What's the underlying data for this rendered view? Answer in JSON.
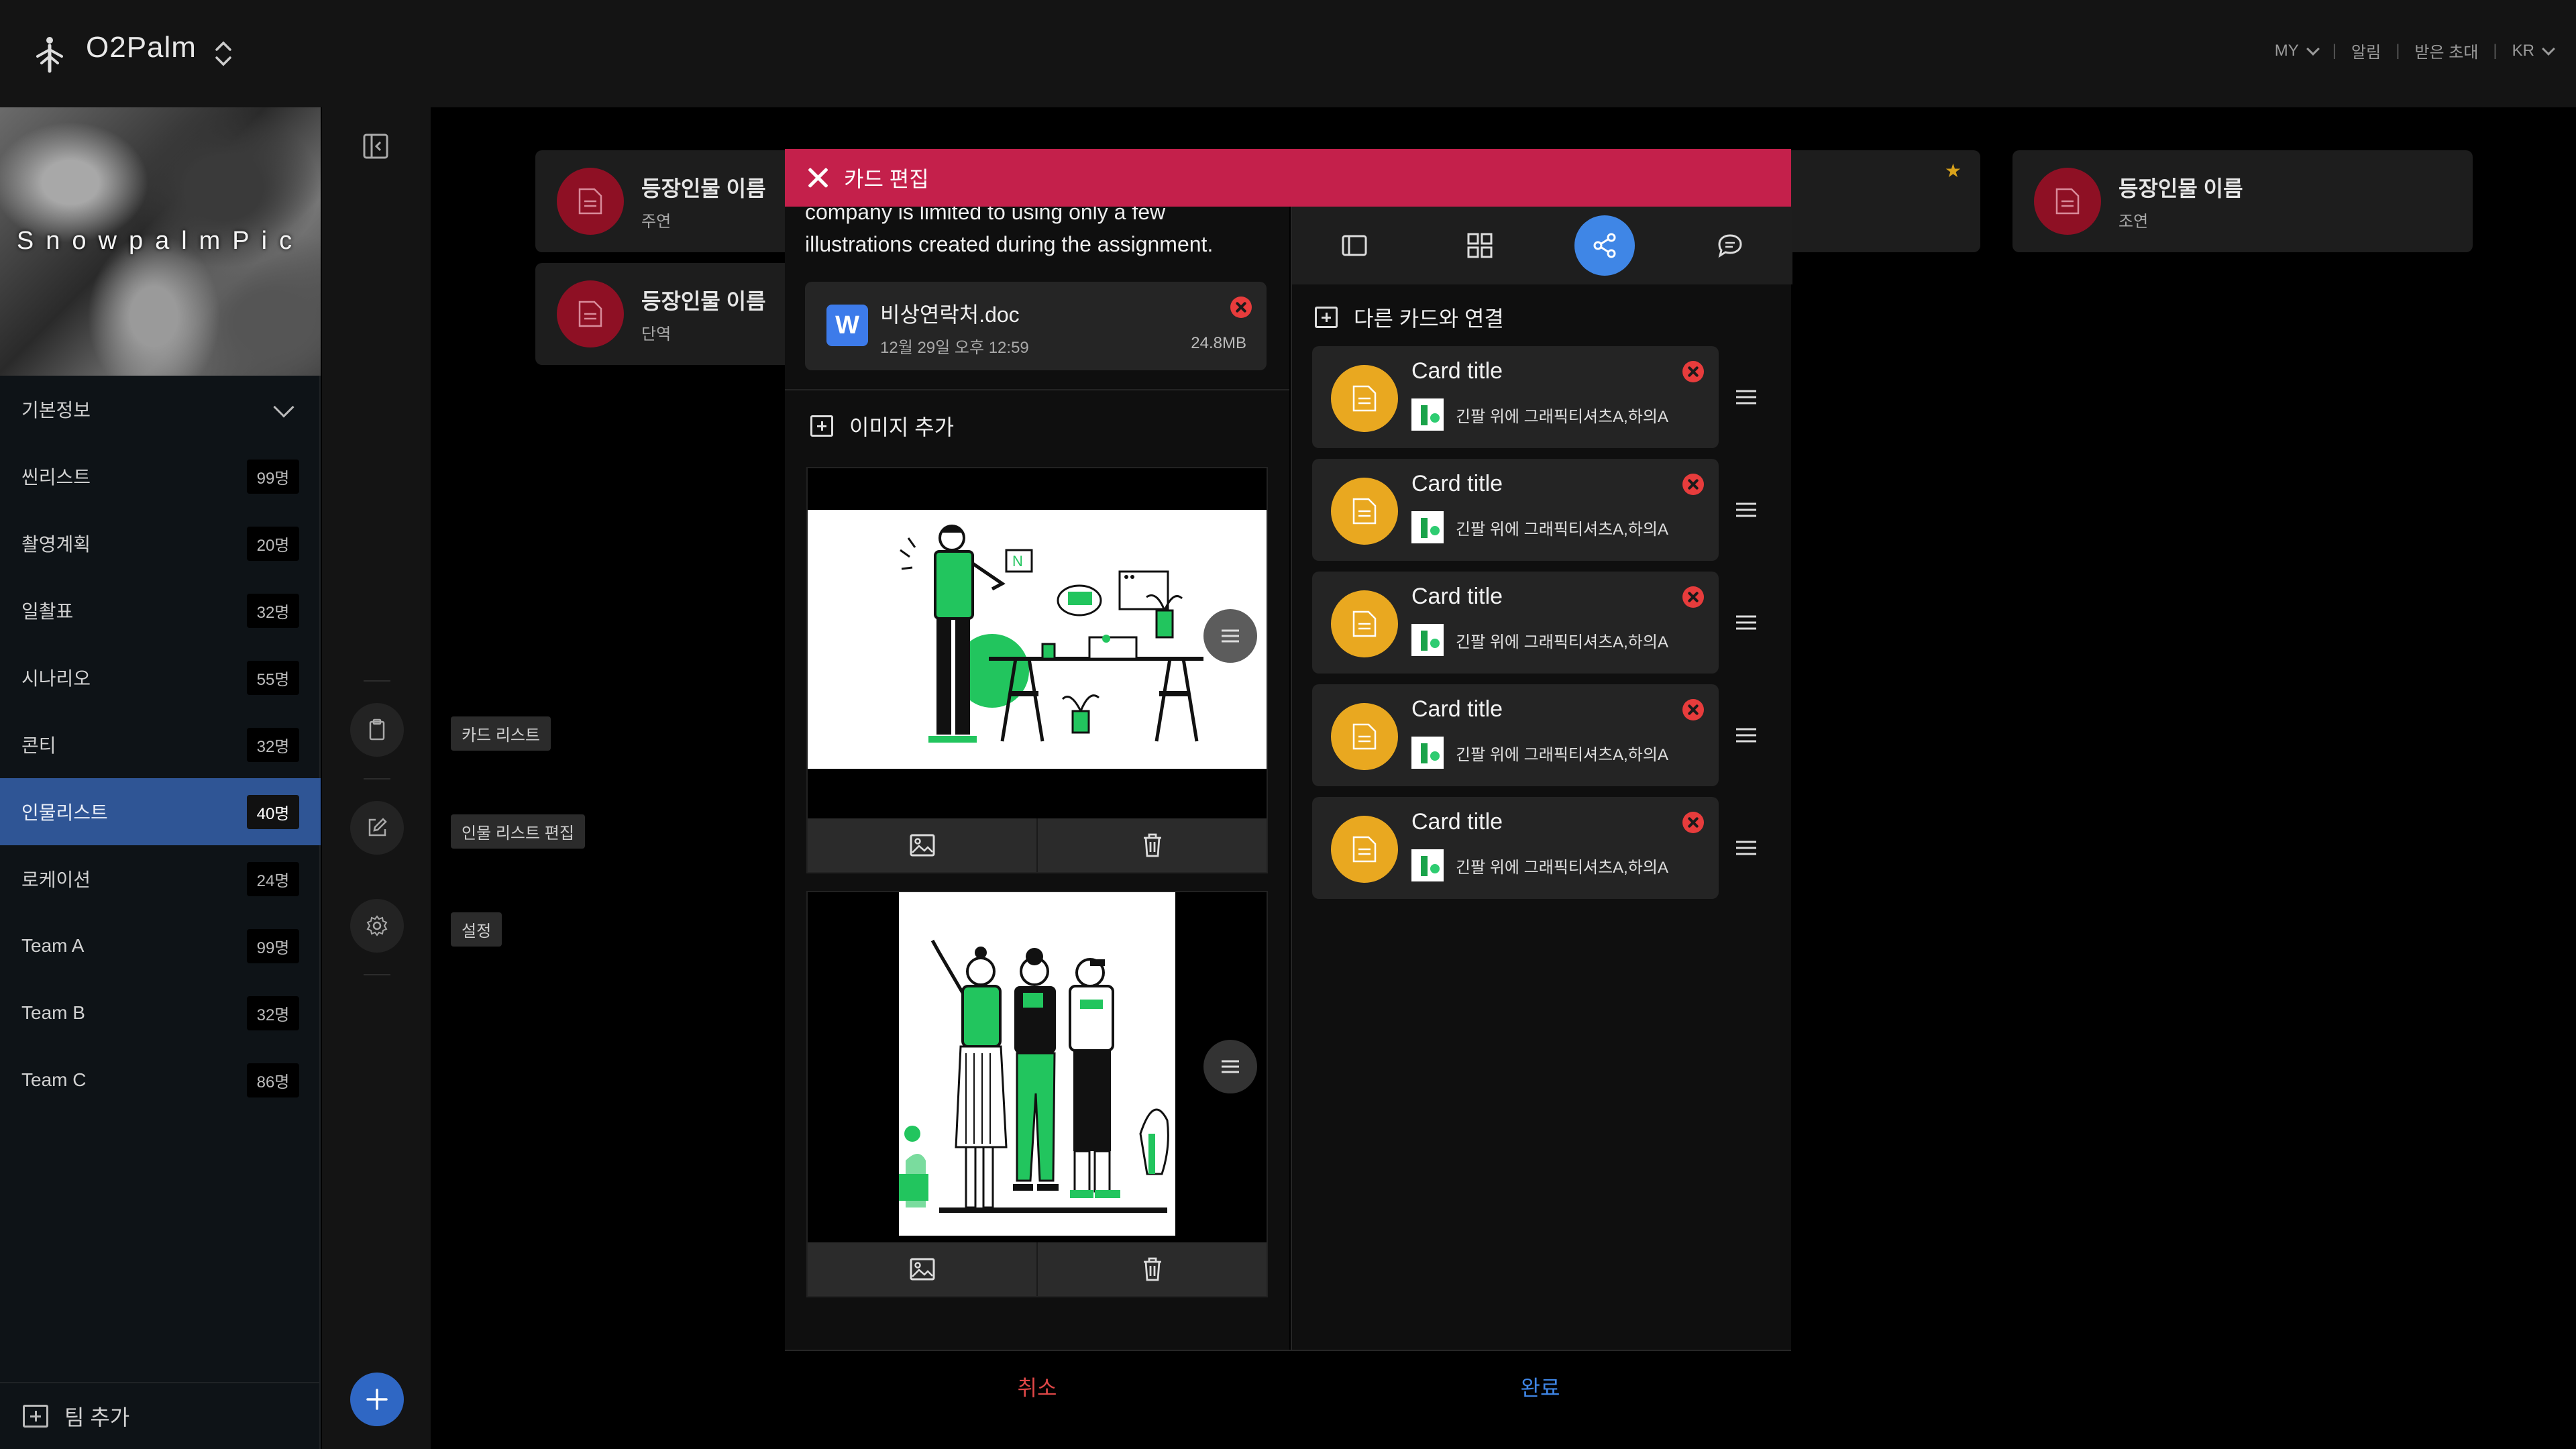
{
  "app": {
    "title": "O2Palm"
  },
  "topnav": [
    {
      "label": "MY",
      "dropdown": true
    },
    {
      "label": "알림",
      "dropdown": false
    },
    {
      "label": "받은 초대",
      "dropdown": false
    },
    {
      "label": "KR",
      "dropdown": true
    }
  ],
  "sidebar": {
    "photo_caption": "SnowpalmPic",
    "section_label": "기본정보",
    "items": [
      {
        "label": "씬리스트",
        "count": "99명"
      },
      {
        "label": "촬영계획",
        "count": "20명"
      },
      {
        "label": "일촬표",
        "count": "32명"
      },
      {
        "label": "시나리오",
        "count": "55명"
      },
      {
        "label": "콘티",
        "count": "32명"
      },
      {
        "label": "인물리스트",
        "count": "40명",
        "active": true
      },
      {
        "label": "로케이션",
        "count": "24명"
      },
      {
        "label": "Team A",
        "count": "99명"
      },
      {
        "label": "Team B",
        "count": "32명"
      },
      {
        "label": "Team C",
        "count": "86명"
      }
    ],
    "team_add_label": "팀 추가"
  },
  "rail": {
    "tooltips": {
      "card_list": "카드 리스트",
      "edit_list": "인물 리스트 편집",
      "settings": "설정"
    }
  },
  "background_cards": [
    {
      "name": "등장인물 이름",
      "role": "주연"
    },
    {
      "name": "등장인물 이름",
      "role": "단역"
    },
    {
      "name": "등장인물 이름",
      "role": "조연"
    }
  ],
  "modal": {
    "title": "카드 편집",
    "description": "company is limited to using only a few illustrations created during the assignment.",
    "attachment": {
      "name": "비상연락처.doc",
      "date": "12월 29일 오후 12:59",
      "size": "24.8MB",
      "icon_letter": "W"
    },
    "add_image_label": "이미지 추가",
    "connect_label": "다른 카드와 연결",
    "linked_cards": [
      {
        "title": "Card title",
        "subtitle": "긴팔 위에 그래픽티셔츠A,하의A"
      },
      {
        "title": "Card title",
        "subtitle": "긴팔 위에 그래픽티셔츠A,하의A"
      },
      {
        "title": "Card title",
        "subtitle": "긴팔 위에 그래픽티셔츠A,하의A"
      },
      {
        "title": "Card title",
        "subtitle": "긴팔 위에 그래픽티셔츠A,하의A"
      },
      {
        "title": "Card title",
        "subtitle": "긴팔 위에 그래픽티셔츠A,하의A"
      }
    ],
    "cancel_label": "취소",
    "done_label": "완료"
  },
  "colors": {
    "accent_red": "#c4204b",
    "accent_blue": "#3f86e6",
    "active_nav": "#2f5595",
    "avatar_red": "#8e1024",
    "avatar_yellow": "#e9a820",
    "illustration_green": "#22c55e"
  }
}
